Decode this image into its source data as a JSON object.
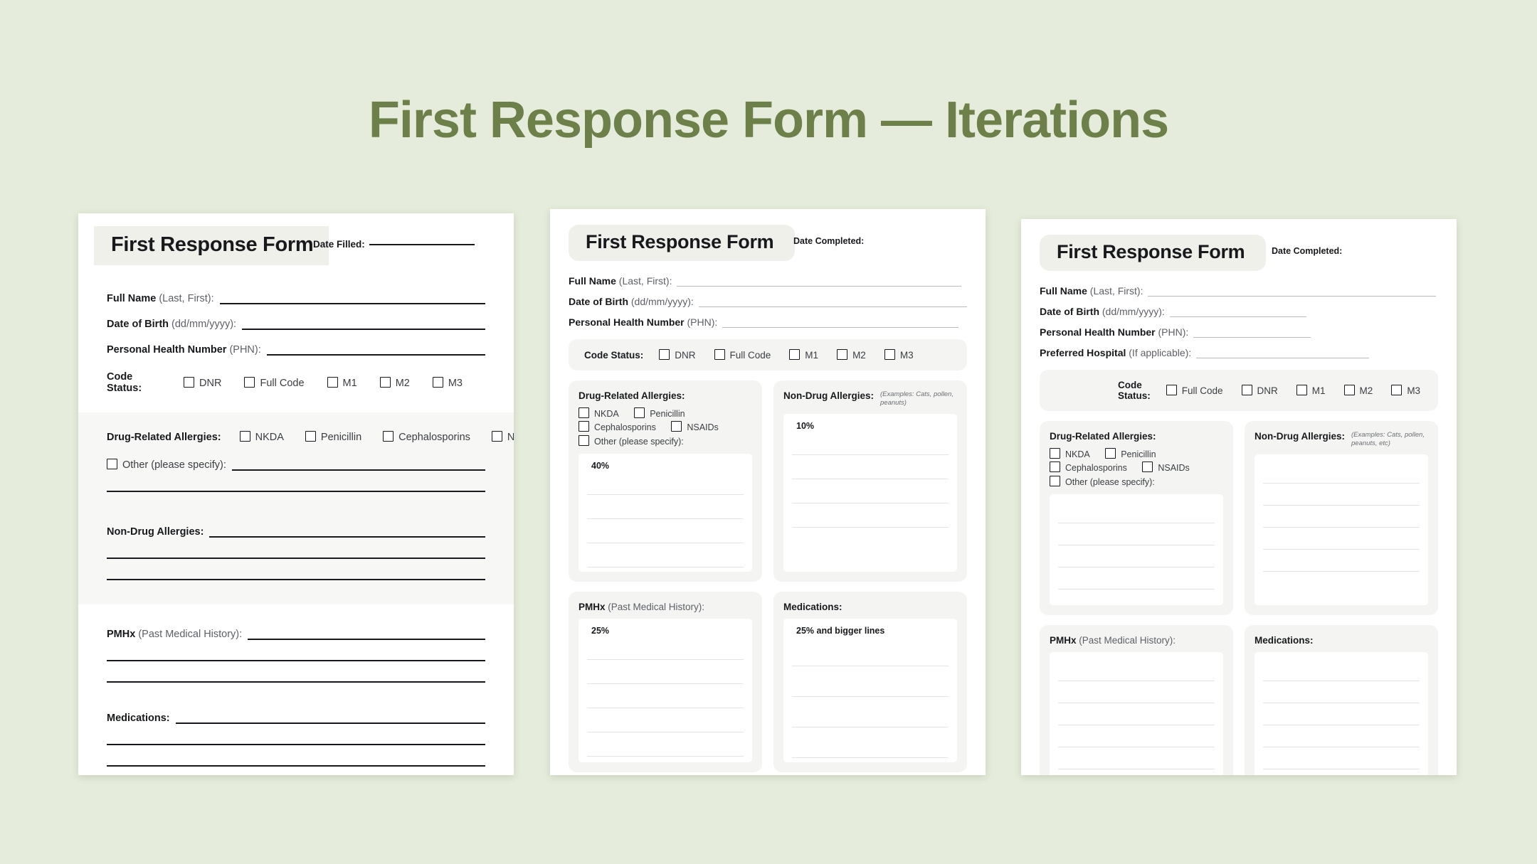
{
  "page": {
    "title": "First Response Form — Iterations",
    "background_color": "#e5ecdb",
    "title_color": "#6d8049"
  },
  "version_1": {
    "form_title": "First Response Form",
    "date_label": "Date Filled:",
    "fields": [
      {
        "label": "Full Name",
        "hint": " (Last, First):"
      },
      {
        "label": "Date of Birth",
        "hint": " (dd/mm/yyyy):"
      },
      {
        "label": "Personal Health Number",
        "hint": " (PHN):"
      }
    ],
    "code_status": {
      "label": "Code Status:",
      "options": [
        "DNR",
        "Full Code",
        "M1",
        "M2",
        "M3"
      ]
    },
    "drug_allergies": {
      "label": "Drug-Related Allergies:",
      "options": [
        "NKDA",
        "Penicillin",
        "Cephalosporins",
        "NSAIDs"
      ],
      "other_label": "Other (please specify):"
    },
    "non_drug_allergies": {
      "label": "Non-Drug Allergies:"
    },
    "pmhx": {
      "label": "PMHx",
      "hint": " (Past Medical History):"
    },
    "medications": {
      "label": "Medications:"
    }
  },
  "version_2": {
    "form_title": "First Response Form",
    "date_label": "Date Completed:",
    "fields": [
      {
        "label": "Full Name",
        "hint": " (Last, First):"
      },
      {
        "label": "Date of Birth",
        "hint": " (dd/mm/yyyy):"
      },
      {
        "label": "Personal Health Number",
        "hint": " (PHN):"
      }
    ],
    "code_status": {
      "label": "Code Status:",
      "options": [
        "DNR",
        "Full Code",
        "M1",
        "M2",
        "M3"
      ]
    },
    "drug_allergies": {
      "label": "Drug-Related Allergies:",
      "options": [
        "NKDA",
        "Penicillin",
        "Cephalosporins",
        "NSAIDs"
      ],
      "other_label": "Other (please specify):",
      "annotation": "40%"
    },
    "non_drug_allergies": {
      "label": "Non-Drug Allergies:",
      "note": "(Examples: Cats, pollen, peanuts)",
      "annotation": "10%"
    },
    "pmhx": {
      "label": "PMHx",
      "hint": " (Past Medical History):",
      "annotation": "25%"
    },
    "medications": {
      "label": "Medications:",
      "annotation": "25% and bigger lines"
    }
  },
  "version_3": {
    "form_title": "First Response Form",
    "date_label": "Date Completed:",
    "fields": [
      {
        "label": "Full Name",
        "hint": " (Last, First):"
      },
      {
        "label": "Date of Birth",
        "hint": " (dd/mm/yyyy):"
      },
      {
        "label": "Personal Health Number",
        "hint": " (PHN):"
      },
      {
        "label": "Preferred Hospital",
        "hint": " (If applicable):"
      }
    ],
    "code_status": {
      "label": "Code Status:",
      "options": [
        "Full Code",
        "DNR",
        "M1",
        "M2",
        "M3"
      ]
    },
    "drug_allergies": {
      "label": "Drug-Related Allergies:",
      "options": [
        "NKDA",
        "Penicillin",
        "Cephalosporins",
        "NSAIDs"
      ],
      "other_label": "Other (please specify):",
      "annotation": ""
    },
    "non_drug_allergies": {
      "label": "Non-Drug Allergies:",
      "note": "(Examples: Cats, pollen, peanuts, etc)",
      "annotation": ""
    },
    "pmhx": {
      "label": "PMHx",
      "hint": " (Past Medical History):",
      "annotation": ""
    },
    "medications": {
      "label": "Medications:",
      "annotation": ""
    }
  }
}
